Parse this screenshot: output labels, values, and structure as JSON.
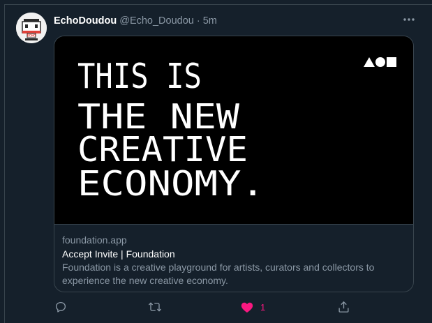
{
  "tweet": {
    "display_name": "EchoDoudou",
    "handle": "@Echo_Doudou",
    "separator": "·",
    "time": "5m",
    "avatar_badge_text": "ECHO"
  },
  "card": {
    "image_headline_lines": [
      "THIS IS",
      "THE NEW",
      "CREATIVE",
      "ECONOMY."
    ],
    "image_logo": "triangle-circle-square-logo",
    "domain": "foundation.app",
    "title": "Accept Invite | Foundation",
    "description": "Foundation is a creative playground for artists, curators and collectors to experience the new creative economy."
  },
  "actions": {
    "reply_icon": "reply-icon",
    "retweet_icon": "retweet-icon",
    "like_icon": "heart-filled-icon",
    "like_count": "1",
    "share_icon": "share-icon"
  },
  "colors": {
    "background": "#15202b",
    "border": "#38444d",
    "text_primary": "#ffffff",
    "text_secondary": "#8b98a5",
    "like_active": "#f91880"
  }
}
